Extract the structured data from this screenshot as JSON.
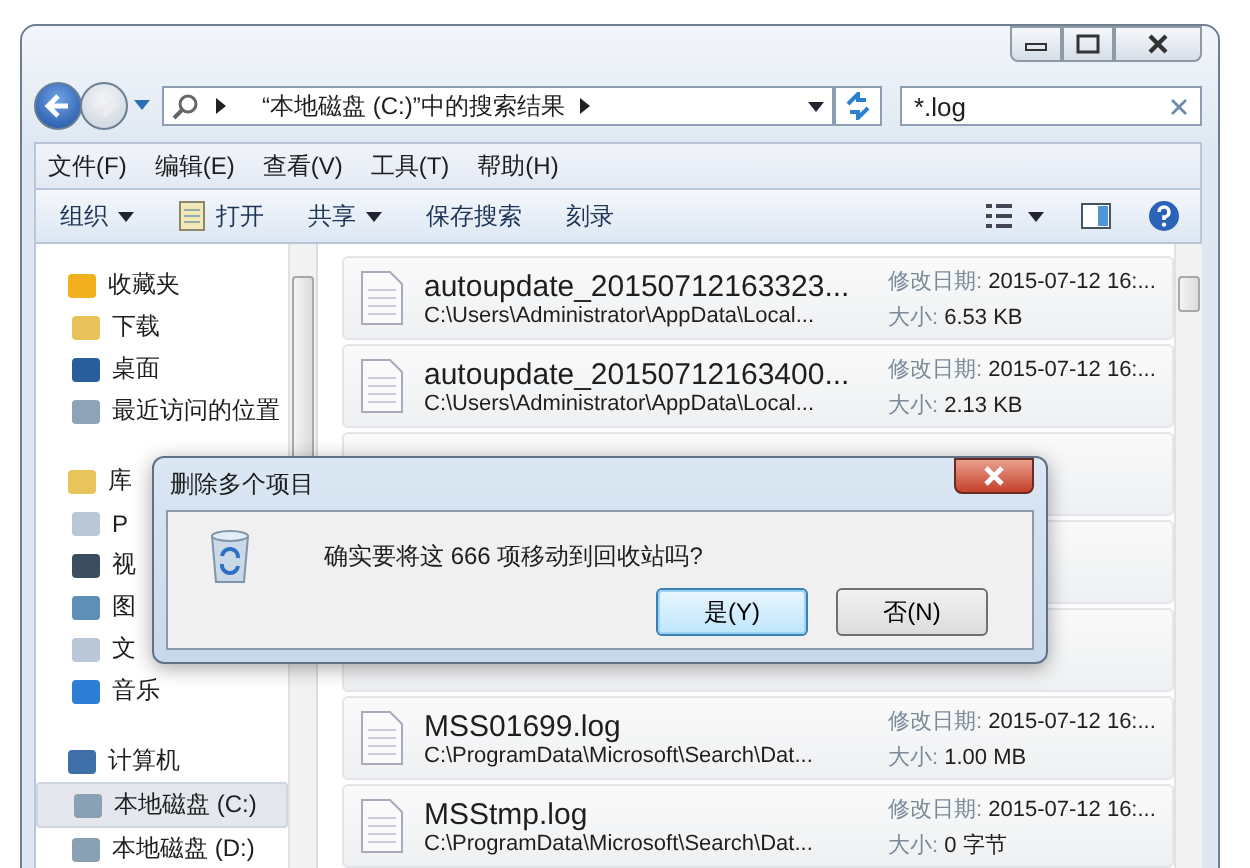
{
  "address": {
    "path": "“本地磁盘 (C:)”中的搜索结果"
  },
  "search": {
    "value": "*.log"
  },
  "menu": [
    "文件(F)",
    "编辑(E)",
    "查看(V)",
    "工具(T)",
    "帮助(H)"
  ],
  "toolbar": [
    {
      "label": "组织",
      "kind": "dropdown"
    },
    {
      "label": "打开",
      "kind": "open"
    },
    {
      "label": "共享",
      "kind": "dropdown"
    },
    {
      "label": "保存搜索",
      "kind": "plain"
    },
    {
      "label": "刻录",
      "kind": "plain"
    }
  ],
  "sidebar": [
    {
      "label": "收藏夹",
      "kind": "star",
      "selected": false,
      "children": [
        {
          "label": "下载",
          "kind": "download",
          "selected": false
        },
        {
          "label": "桌面",
          "kind": "desktop",
          "selected": false
        },
        {
          "label": "最近访问的位置",
          "kind": "recent",
          "selected": false
        }
      ]
    },
    {
      "label": "库",
      "kind": "library",
      "selected": false,
      "children": [
        {
          "label": "P",
          "kind": "doc",
          "selected": false
        },
        {
          "label": "视",
          "kind": "video",
          "selected": false
        },
        {
          "label": "图",
          "kind": "picture",
          "selected": false
        },
        {
          "label": "文",
          "kind": "doc",
          "selected": false
        },
        {
          "label": "音乐",
          "kind": "music",
          "selected": false
        }
      ]
    },
    {
      "label": "计算机",
      "kind": "computer",
      "selected": false,
      "children": [
        {
          "label": "本地磁盘 (C:)",
          "kind": "drive",
          "selected": true
        },
        {
          "label": "本地磁盘 (D:)",
          "kind": "drive",
          "selected": false
        }
      ]
    }
  ],
  "files": [
    {
      "kind": "file",
      "name": "autoupdate_20150712163323...",
      "path": "C:\\Users\\Administrator\\AppData\\Local...",
      "date_label": "修改日期:",
      "date": "2015-07-12 16:...",
      "size_label": "大小:",
      "size": "6.53 KB"
    },
    {
      "kind": "file",
      "name": "autoupdate_20150712163400...",
      "path": "C:\\Users\\Administrator\\AppData\\Local...",
      "date_label": "修改日期:",
      "date": "2015-07-12 16:...",
      "size_label": "大小:",
      "size": "2.13 KB"
    },
    {
      "kind": "covered"
    },
    {
      "kind": "covered"
    },
    {
      "kind": "covered"
    },
    {
      "kind": "file",
      "name": "MSS01699.log",
      "path": "C:\\ProgramData\\Microsoft\\Search\\Dat...",
      "date_label": "修改日期:",
      "date": "2015-07-12 16:...",
      "size_label": "大小:",
      "size": "1.00 MB"
    },
    {
      "kind": "file",
      "name": "MSStmp.log",
      "path": "C:\\ProgramData\\Microsoft\\Search\\Dat...",
      "date_label": "修改日期:",
      "date": "2015-07-12 16:...",
      "size_label": "大小:",
      "size": "0 字节"
    }
  ],
  "dialog": {
    "title": "删除多个项目",
    "message": "确实要将这 666 项移动到回收站吗?",
    "buttons": [
      {
        "label": "是(Y)",
        "selected": true
      },
      {
        "label": "否(N)",
        "selected": false
      }
    ]
  }
}
